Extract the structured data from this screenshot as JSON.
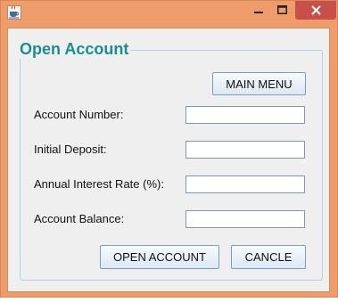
{
  "window": {
    "title": "",
    "icon": "java-coffee-cup-icon",
    "controls": {
      "minimize_icon": "minimize-icon",
      "maximize_icon": "maximize-icon",
      "close_icon": "close-icon"
    }
  },
  "form": {
    "group_title": "Open Account",
    "main_menu_label": "MAIN MENU",
    "fields": [
      {
        "label": "Account Number:",
        "value": ""
      },
      {
        "label": "Initial Deposit:",
        "value": ""
      },
      {
        "label": "Annual Interest Rate (%):",
        "value": ""
      },
      {
        "label": "Account Balance:",
        "value": ""
      }
    ],
    "open_account_label": "OPEN ACCOUNT",
    "cancel_label": "CANCLE"
  },
  "colors": {
    "title_bar": "#ef9c6b",
    "close_button": "#c7504a",
    "group_title_text": "#1b8e8e",
    "client_background": "#efefef"
  }
}
